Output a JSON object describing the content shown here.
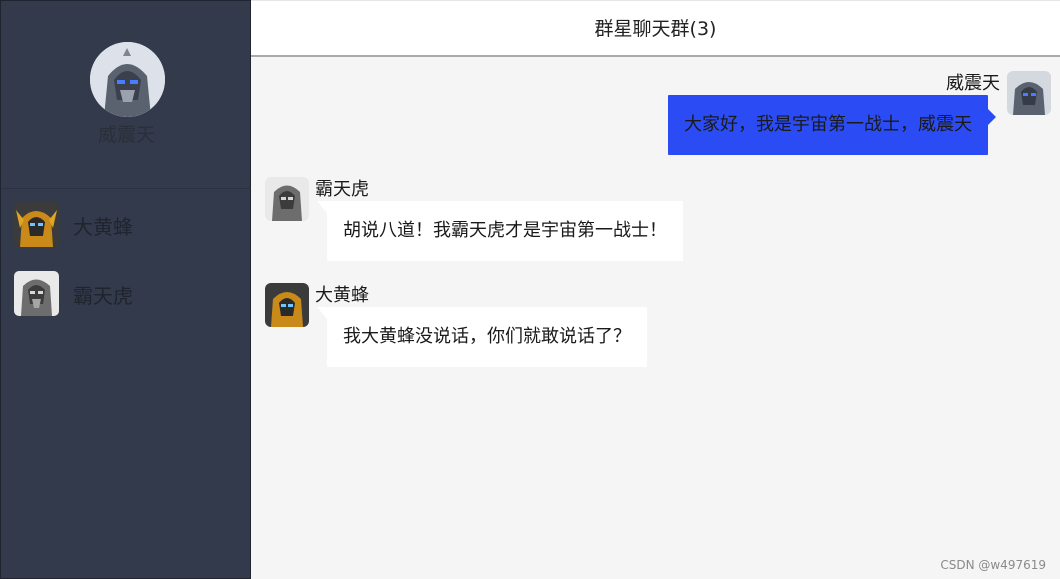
{
  "current_user": {
    "name": "威震天",
    "avatar_icon": "megatron-avatar-icon"
  },
  "contacts": [
    {
      "name": "大黄蜂",
      "avatar_icon": "bumblebee-avatar-icon"
    },
    {
      "name": "霸天虎",
      "avatar_icon": "decepticon-avatar-icon"
    }
  ],
  "chat": {
    "title": "群星聊天群(3)",
    "messages": [
      {
        "sender": "威震天",
        "text": "大家好，我是宇宙第一战士，威震天",
        "self": true
      },
      {
        "sender": "霸天虎",
        "text": "胡说八道！我霸天虎才是宇宙第一战士！",
        "self": false
      },
      {
        "sender": "大黄蜂",
        "text": "我大黄蜂没说话，你们就敢说话了？",
        "self": false
      }
    ]
  },
  "watermark": "CSDN @w497619",
  "colors": {
    "sidebar": "#323a4b",
    "self_bubble": "#2b4cf5",
    "chat_bg": "#f5f5f5"
  }
}
